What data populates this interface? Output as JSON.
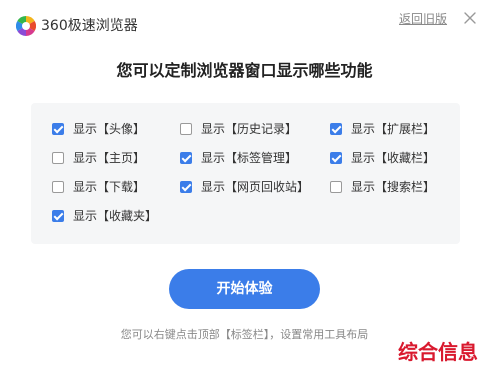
{
  "header": {
    "app_title": "360极速浏览器",
    "back_link": "返回旧版",
    "close_icon": "close-icon",
    "logo_icon": "browser-logo-icon"
  },
  "heading": "您可以定制浏览器窗口显示哪些功能",
  "options": [
    {
      "label": "显示【头像】",
      "checked": true
    },
    {
      "label": "显示【历史记录】",
      "checked": false
    },
    {
      "label": "显示【扩展栏】",
      "checked": true
    },
    {
      "label": "显示【主页】",
      "checked": false
    },
    {
      "label": "显示【标签管理】",
      "checked": true
    },
    {
      "label": "显示【收藏栏】",
      "checked": true
    },
    {
      "label": "显示【下载】",
      "checked": false
    },
    {
      "label": "显示【网页回收站】",
      "checked": true
    },
    {
      "label": "显示【搜索栏】",
      "checked": false
    },
    {
      "label": "显示【收藏夹】",
      "checked": true
    }
  ],
  "start_button": "开始体验",
  "hint": "您可以右键点击顶部【标签栏】，设置常用工具布局",
  "watermark": "综合信息",
  "colors": {
    "accent": "#3b7de9",
    "panel_bg": "#f5f6f7",
    "watermark": "#d9192e"
  }
}
